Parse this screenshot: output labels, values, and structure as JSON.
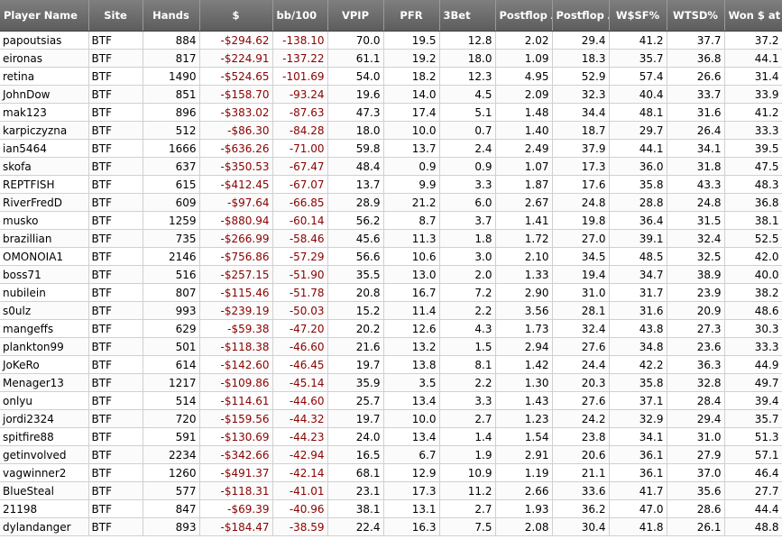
{
  "columns": [
    {
      "key": "player",
      "label": "Player Name",
      "align": "left"
    },
    {
      "key": "site",
      "label": "Site",
      "align": "center"
    },
    {
      "key": "hands",
      "label": "Hands",
      "align": "center"
    },
    {
      "key": "money",
      "label": "$",
      "align": "center"
    },
    {
      "key": "bb100",
      "label": "bb/100",
      "align": "left"
    },
    {
      "key": "vpip",
      "label": "VPIP",
      "align": "center"
    },
    {
      "key": "pfr",
      "label": "PFR",
      "align": "center"
    },
    {
      "key": "threebet",
      "label": "3Bet",
      "align": "left"
    },
    {
      "key": "pf_agg",
      "label": "Postflop Agg",
      "align": "left"
    },
    {
      "key": "pf_aggpct",
      "label": "Postflop Agg%",
      "align": "left"
    },
    {
      "key": "wsf",
      "label": "W$SF%",
      "align": "center"
    },
    {
      "key": "wtsd",
      "label": "WTSD%",
      "align": "center"
    },
    {
      "key": "wsd",
      "label": "Won $ at SD",
      "align": "left"
    }
  ],
  "rows": [
    {
      "player": "papoutsias",
      "site": "BTF",
      "hands": "884",
      "money": "-$294.62",
      "bb100": "-138.10",
      "vpip": "70.0",
      "pfr": "19.5",
      "threebet": "12.8",
      "pf_agg": "2.02",
      "pf_aggpct": "29.4",
      "wsf": "41.2",
      "wtsd": "37.7",
      "wsd": "37.2"
    },
    {
      "player": "eironas",
      "site": "BTF",
      "hands": "817",
      "money": "-$224.91",
      "bb100": "-137.22",
      "vpip": "61.1",
      "pfr": "19.2",
      "threebet": "18.0",
      "pf_agg": "1.09",
      "pf_aggpct": "18.3",
      "wsf": "35.7",
      "wtsd": "36.8",
      "wsd": "44.1"
    },
    {
      "player": "retina",
      "site": "BTF",
      "hands": "1490",
      "money": "-$524.65",
      "bb100": "-101.69",
      "vpip": "54.0",
      "pfr": "18.2",
      "threebet": "12.3",
      "pf_agg": "4.95",
      "pf_aggpct": "52.9",
      "wsf": "57.4",
      "wtsd": "26.6",
      "wsd": "31.4"
    },
    {
      "player": "JohnDow",
      "site": "BTF",
      "hands": "851",
      "money": "-$158.70",
      "bb100": "-93.24",
      "vpip": "19.6",
      "pfr": "14.0",
      "threebet": "4.5",
      "pf_agg": "2.09",
      "pf_aggpct": "32.3",
      "wsf": "40.4",
      "wtsd": "33.7",
      "wsd": "33.9"
    },
    {
      "player": "mak123",
      "site": "BTF",
      "hands": "896",
      "money": "-$383.02",
      "bb100": "-87.63",
      "vpip": "47.3",
      "pfr": "17.4",
      "threebet": "5.1",
      "pf_agg": "1.48",
      "pf_aggpct": "34.4",
      "wsf": "48.1",
      "wtsd": "31.6",
      "wsd": "41.2"
    },
    {
      "player": "karpiczyzna",
      "site": "BTF",
      "hands": "512",
      "money": "-$86.30",
      "bb100": "-84.28",
      "vpip": "18.0",
      "pfr": "10.0",
      "threebet": "0.7",
      "pf_agg": "1.40",
      "pf_aggpct": "18.7",
      "wsf": "29.7",
      "wtsd": "26.4",
      "wsd": "33.3"
    },
    {
      "player": "ian5464",
      "site": "BTF",
      "hands": "1666",
      "money": "-$636.26",
      "bb100": "-71.00",
      "vpip": "59.8",
      "pfr": "13.7",
      "threebet": "2.4",
      "pf_agg": "2.49",
      "pf_aggpct": "37.9",
      "wsf": "44.1",
      "wtsd": "34.1",
      "wsd": "39.5"
    },
    {
      "player": "skofa",
      "site": "BTF",
      "hands": "637",
      "money": "-$350.53",
      "bb100": "-67.47",
      "vpip": "48.4",
      "pfr": "0.9",
      "threebet": "0.9",
      "pf_agg": "1.07",
      "pf_aggpct": "17.3",
      "wsf": "36.0",
      "wtsd": "31.8",
      "wsd": "47.5"
    },
    {
      "player": "REPTFISH",
      "site": "BTF",
      "hands": "615",
      "money": "-$412.45",
      "bb100": "-67.07",
      "vpip": "13.7",
      "pfr": "9.9",
      "threebet": "3.3",
      "pf_agg": "1.87",
      "pf_aggpct": "17.6",
      "wsf": "35.8",
      "wtsd": "43.3",
      "wsd": "48.3"
    },
    {
      "player": "RiverFredD",
      "site": "BTF",
      "hands": "609",
      "money": "-$97.64",
      "bb100": "-66.85",
      "vpip": "28.9",
      "pfr": "21.2",
      "threebet": "6.0",
      "pf_agg": "2.67",
      "pf_aggpct": "24.8",
      "wsf": "28.8",
      "wtsd": "24.8",
      "wsd": "36.8"
    },
    {
      "player": "musko",
      "site": "BTF",
      "hands": "1259",
      "money": "-$880.94",
      "bb100": "-60.14",
      "vpip": "56.2",
      "pfr": "8.7",
      "threebet": "3.7",
      "pf_agg": "1.41",
      "pf_aggpct": "19.8",
      "wsf": "36.4",
      "wtsd": "31.5",
      "wsd": "38.1"
    },
    {
      "player": "brazillian",
      "site": "BTF",
      "hands": "735",
      "money": "-$266.99",
      "bb100": "-58.46",
      "vpip": "45.6",
      "pfr": "11.3",
      "threebet": "1.8",
      "pf_agg": "1.72",
      "pf_aggpct": "27.0",
      "wsf": "39.1",
      "wtsd": "32.4",
      "wsd": "52.5"
    },
    {
      "player": "OMONOIA1",
      "site": "BTF",
      "hands": "2146",
      "money": "-$756.86",
      "bb100": "-57.29",
      "vpip": "56.6",
      "pfr": "10.6",
      "threebet": "3.0",
      "pf_agg": "2.10",
      "pf_aggpct": "34.5",
      "wsf": "48.5",
      "wtsd": "32.5",
      "wsd": "42.0"
    },
    {
      "player": "boss71",
      "site": "BTF",
      "hands": "516",
      "money": "-$257.15",
      "bb100": "-51.90",
      "vpip": "35.5",
      "pfr": "13.0",
      "threebet": "2.0",
      "pf_agg": "1.33",
      "pf_aggpct": "19.4",
      "wsf": "34.7",
      "wtsd": "38.9",
      "wsd": "40.0"
    },
    {
      "player": "nubilein",
      "site": "BTF",
      "hands": "807",
      "money": "-$115.46",
      "bb100": "-51.78",
      "vpip": "20.8",
      "pfr": "16.7",
      "threebet": "7.2",
      "pf_agg": "2.90",
      "pf_aggpct": "31.0",
      "wsf": "31.7",
      "wtsd": "23.9",
      "wsd": "38.2"
    },
    {
      "player": "s0ulz",
      "site": "BTF",
      "hands": "993",
      "money": "-$239.19",
      "bb100": "-50.03",
      "vpip": "15.2",
      "pfr": "11.4",
      "threebet": "2.2",
      "pf_agg": "3.56",
      "pf_aggpct": "28.1",
      "wsf": "31.6",
      "wtsd": "20.9",
      "wsd": "48.6"
    },
    {
      "player": "mangeffs",
      "site": "BTF",
      "hands": "629",
      "money": "-$59.38",
      "bb100": "-47.20",
      "vpip": "20.2",
      "pfr": "12.6",
      "threebet": "4.3",
      "pf_agg": "1.73",
      "pf_aggpct": "32.4",
      "wsf": "43.8",
      "wtsd": "27.3",
      "wsd": "30.3"
    },
    {
      "player": "plankton99",
      "site": "BTF",
      "hands": "501",
      "money": "-$118.38",
      "bb100": "-46.60",
      "vpip": "21.6",
      "pfr": "13.2",
      "threebet": "1.5",
      "pf_agg": "2.94",
      "pf_aggpct": "27.6",
      "wsf": "34.8",
      "wtsd": "23.6",
      "wsd": "33.3"
    },
    {
      "player": "JoKeRo",
      "site": "BTF",
      "hands": "614",
      "money": "-$142.60",
      "bb100": "-46.45",
      "vpip": "19.7",
      "pfr": "13.8",
      "threebet": "8.1",
      "pf_agg": "1.42",
      "pf_aggpct": "24.4",
      "wsf": "42.2",
      "wtsd": "36.3",
      "wsd": "44.9"
    },
    {
      "player": "Menager13",
      "site": "BTF",
      "hands": "1217",
      "money": "-$109.86",
      "bb100": "-45.14",
      "vpip": "35.9",
      "pfr": "3.5",
      "threebet": "2.2",
      "pf_agg": "1.30",
      "pf_aggpct": "20.3",
      "wsf": "35.8",
      "wtsd": "32.8",
      "wsd": "49.7"
    },
    {
      "player": "onlyu",
      "site": "BTF",
      "hands": "514",
      "money": "-$114.61",
      "bb100": "-44.60",
      "vpip": "25.7",
      "pfr": "13.4",
      "threebet": "3.3",
      "pf_agg": "1.43",
      "pf_aggpct": "27.6",
      "wsf": "37.1",
      "wtsd": "28.4",
      "wsd": "39.4"
    },
    {
      "player": "jordi2324",
      "site": "BTF",
      "hands": "720",
      "money": "-$159.56",
      "bb100": "-44.32",
      "vpip": "19.7",
      "pfr": "10.0",
      "threebet": "2.7",
      "pf_agg": "1.23",
      "pf_aggpct": "24.2",
      "wsf": "32.9",
      "wtsd": "29.4",
      "wsd": "35.7"
    },
    {
      "player": "spitfire88",
      "site": "BTF",
      "hands": "591",
      "money": "-$130.69",
      "bb100": "-44.23",
      "vpip": "24.0",
      "pfr": "13.4",
      "threebet": "1.4",
      "pf_agg": "1.54",
      "pf_aggpct": "23.8",
      "wsf": "34.1",
      "wtsd": "31.0",
      "wsd": "51.3"
    },
    {
      "player": "getinvolved",
      "site": "BTF",
      "hands": "2234",
      "money": "-$342.66",
      "bb100": "-42.94",
      "vpip": "16.5",
      "pfr": "6.7",
      "threebet": "1.9",
      "pf_agg": "2.91",
      "pf_aggpct": "20.6",
      "wsf": "36.1",
      "wtsd": "27.9",
      "wsd": "57.1"
    },
    {
      "player": "vagwinner2",
      "site": "BTF",
      "hands": "1260",
      "money": "-$491.37",
      "bb100": "-42.14",
      "vpip": "68.1",
      "pfr": "12.9",
      "threebet": "10.9",
      "pf_agg": "1.19",
      "pf_aggpct": "21.1",
      "wsf": "36.1",
      "wtsd": "37.0",
      "wsd": "46.4"
    },
    {
      "player": "BlueSteal",
      "site": "BTF",
      "hands": "577",
      "money": "-$118.31",
      "bb100": "-41.01",
      "vpip": "23.1",
      "pfr": "17.3",
      "threebet": "11.2",
      "pf_agg": "2.66",
      "pf_aggpct": "33.6",
      "wsf": "41.7",
      "wtsd": "35.6",
      "wsd": "27.7"
    },
    {
      "player": "21198",
      "site": "BTF",
      "hands": "847",
      "money": "-$69.39",
      "bb100": "-40.96",
      "vpip": "38.1",
      "pfr": "13.1",
      "threebet": "2.7",
      "pf_agg": "1.93",
      "pf_aggpct": "36.2",
      "wsf": "47.0",
      "wtsd": "28.6",
      "wsd": "44.4"
    },
    {
      "player": "dylandanger",
      "site": "BTF",
      "hands": "893",
      "money": "-$184.47",
      "bb100": "-38.59",
      "vpip": "22.4",
      "pfr": "16.3",
      "threebet": "7.5",
      "pf_agg": "2.08",
      "pf_aggpct": "30.4",
      "wsf": "41.8",
      "wtsd": "26.1",
      "wsd": "48.8"
    }
  ]
}
